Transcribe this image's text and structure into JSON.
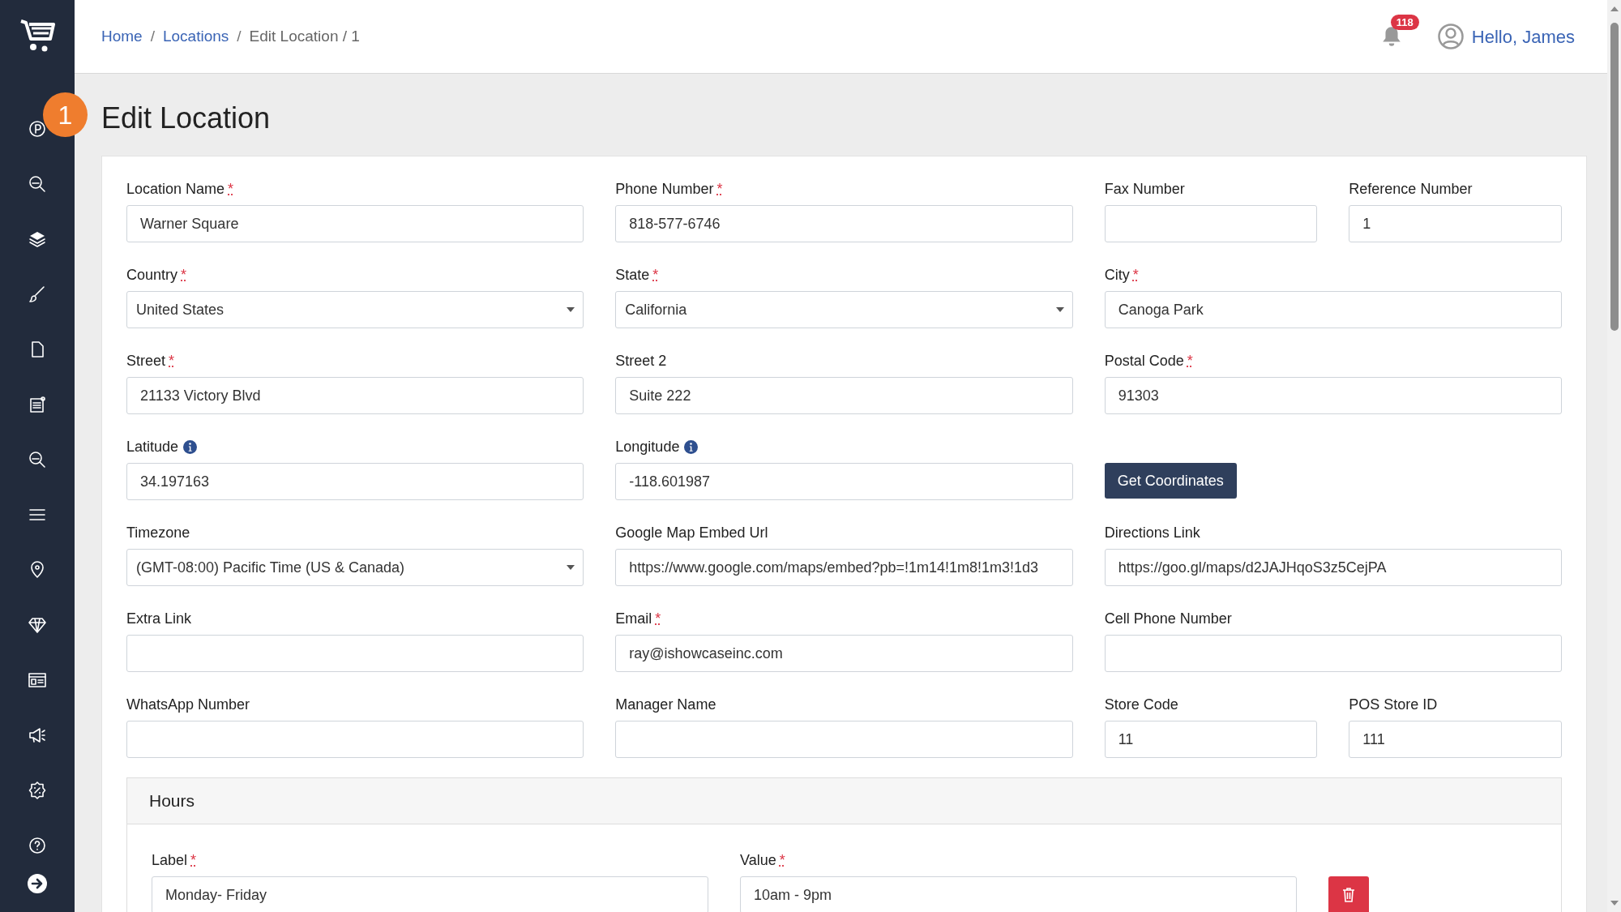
{
  "badge": "1",
  "breadcrumb": [
    {
      "label": "Home",
      "link": true
    },
    {
      "label": "Locations",
      "link": true
    },
    {
      "label": "Edit Location / 1",
      "link": false
    }
  ],
  "breadcrumb_separator": "/",
  "notifications": "118",
  "user": "Hello, James",
  "title": "Edit Location",
  "required_mark": "*",
  "rows": [
    [
      {
        "kind": "text",
        "label": "Location Name",
        "required": true,
        "value": "Warner Square"
      },
      {
        "kind": "text",
        "label": "Phone Number",
        "required": true,
        "value": "818-577-6746"
      },
      {
        "kind": "text",
        "label": "Fax Number",
        "required": false
      },
      {
        "kind": "text",
        "label": "Reference Number",
        "required": false,
        "value": "1"
      }
    ],
    [
      {
        "kind": "select",
        "label": "Country",
        "required": true,
        "value": "United States"
      },
      {
        "kind": "select",
        "label": "State",
        "required": true,
        "value": "California"
      },
      {
        "kind": "text",
        "label": "City",
        "required": true,
        "value": "Canoga Park"
      }
    ],
    [
      {
        "kind": "text",
        "label": "Street",
        "required": true,
        "value": "21133 Victory Blvd"
      },
      {
        "kind": "text",
        "label": "Street 2",
        "required": false,
        "value": "Suite 222"
      },
      {
        "kind": "text",
        "label": "Postal Code",
        "required": true,
        "value": "91303"
      }
    ],
    [
      {
        "kind": "text",
        "label": "Latitude",
        "required": false,
        "info": true,
        "value": "34.197163"
      },
      {
        "kind": "text",
        "label": "Longitude",
        "required": false,
        "info": true,
        "value": "-118.601987"
      },
      {
        "kind": "button",
        "label": "Get Coordinates"
      }
    ],
    [
      {
        "kind": "select",
        "label": "Timezone",
        "required": false,
        "value": "(GMT-08:00) Pacific Time (US & Canada)"
      },
      {
        "kind": "text",
        "label": "Google Map Embed Url",
        "required": false,
        "value": "https://www.google.com/maps/embed?pb=!1m14!1m8!1m3!1d3"
      },
      {
        "kind": "text",
        "label": "Directions Link",
        "required": false,
        "value": "https://goo.gl/maps/d2JAJHqoS3z5CejPA"
      }
    ],
    [
      {
        "kind": "text",
        "label": "Extra Link",
        "required": false
      },
      {
        "kind": "text",
        "label": "Email",
        "required": true,
        "value": "ray@ishowcaseinc.com"
      },
      {
        "kind": "text",
        "label": "Cell Phone Number",
        "required": false
      }
    ],
    [
      {
        "kind": "text",
        "label": "WhatsApp Number",
        "required": false
      },
      {
        "kind": "text",
        "label": "Manager Name",
        "required": false
      },
      {
        "kind": "text",
        "label": "Store Code",
        "required": false,
        "value": "11"
      },
      {
        "kind": "text",
        "label": "POS Store ID",
        "required": false,
        "value": "111"
      }
    ]
  ],
  "hours": {
    "title": "Hours",
    "rows": [
      [
        {
          "label": "Label",
          "required": true,
          "value": "Monday- Friday"
        },
        {
          "label": "Value",
          "required": true,
          "value": "10am - 9pm"
        }
      ]
    ]
  }
}
